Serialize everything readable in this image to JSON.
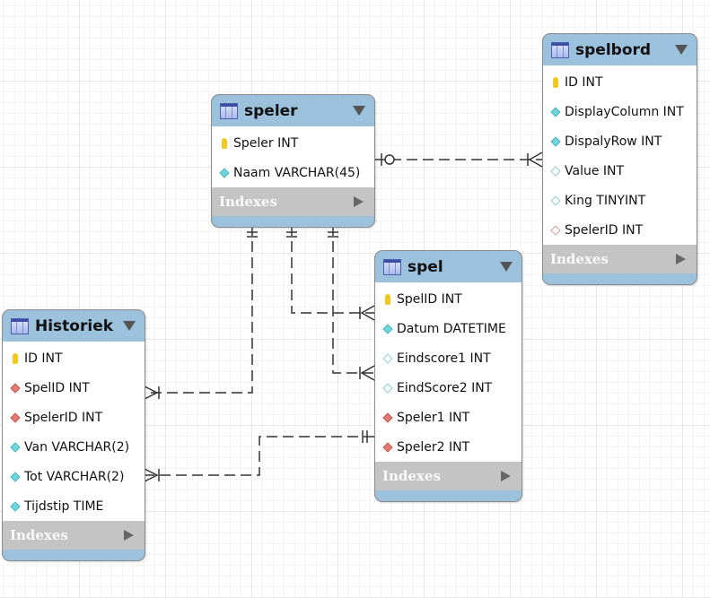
{
  "indexes_label": "Indexes",
  "tables": {
    "spelbord": {
      "name": "spelbord",
      "columns": [
        {
          "label": "ID INT",
          "icon": "primary-key-icon"
        },
        {
          "label": "DisplayColumn INT",
          "icon": "not-null-column-icon"
        },
        {
          "label": "DispalyRow INT",
          "icon": "not-null-column-icon"
        },
        {
          "label": "Value INT",
          "icon": "nullable-column-icon"
        },
        {
          "label": "King TINYINT",
          "icon": "nullable-column-icon"
        },
        {
          "label": "SpelerID INT",
          "icon": "nullable-foreign-key-icon"
        }
      ]
    },
    "speler": {
      "name": "speler",
      "columns": [
        {
          "label": "Speler INT",
          "icon": "primary-key-icon"
        },
        {
          "label": "Naam VARCHAR(45)",
          "icon": "not-null-column-icon"
        }
      ]
    },
    "spel": {
      "name": "spel",
      "columns": [
        {
          "label": "SpelID INT",
          "icon": "primary-key-icon"
        },
        {
          "label": "Datum DATETIME",
          "icon": "not-null-column-icon"
        },
        {
          "label": "Eindscore1 INT",
          "icon": "nullable-column-icon"
        },
        {
          "label": "EindScore2 INT",
          "icon": "nullable-column-icon"
        },
        {
          "label": "Speler1 INT",
          "icon": "foreign-key-icon"
        },
        {
          "label": "Speler2 INT",
          "icon": "foreign-key-icon"
        }
      ]
    },
    "historiek": {
      "name": "Historiek",
      "columns": [
        {
          "label": "ID INT",
          "icon": "primary-key-icon"
        },
        {
          "label": "SpelID INT",
          "icon": "foreign-key-icon"
        },
        {
          "label": "SpelerID INT",
          "icon": "foreign-key-icon"
        },
        {
          "label": "Van VARCHAR(2)",
          "icon": "not-null-column-icon"
        },
        {
          "label": "Tot VARCHAR(2)",
          "icon": "not-null-column-icon"
        },
        {
          "label": "Tijdstip TIME",
          "icon": "not-null-column-icon"
        }
      ]
    }
  },
  "colors": {
    "header": "#9bc1dc",
    "indexes_bar": "#c4c4c4",
    "line": "#333333"
  }
}
